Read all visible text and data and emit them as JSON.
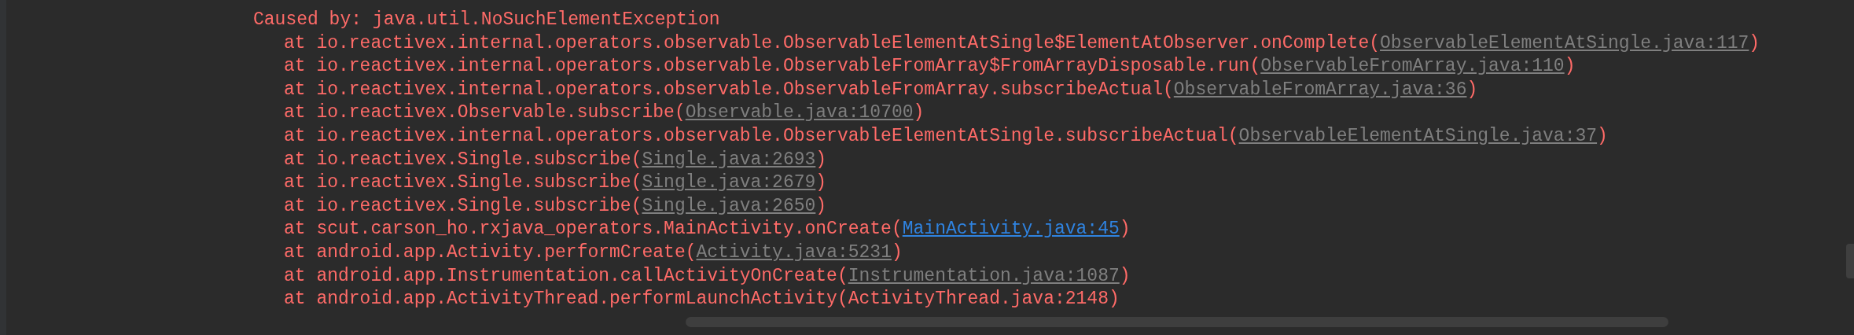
{
  "console": {
    "lines": [
      {
        "kind": "cause",
        "text": "Caused by: java.util.NoSuchElementException"
      },
      {
        "kind": "frame",
        "text": "at io.reactivex.internal.operators.observable.ObservableElementAtSingle$ElementAtObserver.onComplete(",
        "link": {
          "kind": "library",
          "text": "ObservableElementAtSingle.java:117"
        },
        "tail": ")"
      },
      {
        "kind": "frame",
        "text": "at io.reactivex.internal.operators.observable.ObservableFromArray$FromArrayDisposable.run(",
        "link": {
          "kind": "library",
          "text": "ObservableFromArray.java:110"
        },
        "tail": ")"
      },
      {
        "kind": "frame",
        "text": "at io.reactivex.internal.operators.observable.ObservableFromArray.subscribeActual(",
        "link": {
          "kind": "library",
          "text": "ObservableFromArray.java:36"
        },
        "tail": ")"
      },
      {
        "kind": "frame",
        "text": "at io.reactivex.Observable.subscribe(",
        "link": {
          "kind": "library",
          "text": "Observable.java:10700"
        },
        "tail": ")"
      },
      {
        "kind": "frame",
        "text": "at io.reactivex.internal.operators.observable.ObservableElementAtSingle.subscribeActual(",
        "link": {
          "kind": "library",
          "text": "ObservableElementAtSingle.java:37"
        },
        "tail": ")"
      },
      {
        "kind": "frame",
        "text": "at io.reactivex.Single.subscribe(",
        "link": {
          "kind": "library",
          "text": "Single.java:2693"
        },
        "tail": ")"
      },
      {
        "kind": "frame",
        "text": "at io.reactivex.Single.subscribe(",
        "link": {
          "kind": "library",
          "text": "Single.java:2679"
        },
        "tail": ")"
      },
      {
        "kind": "frame",
        "text": "at io.reactivex.Single.subscribe(",
        "link": {
          "kind": "library",
          "text": "Single.java:2650"
        },
        "tail": ")"
      },
      {
        "kind": "frame",
        "text": "at scut.carson_ho.rxjava_operators.MainActivity.onCreate(",
        "link": {
          "kind": "project",
          "text": "MainActivity.java:45"
        },
        "tail": ")"
      },
      {
        "kind": "frame",
        "text": "at android.app.Activity.performCreate(",
        "link": {
          "kind": "library",
          "text": "Activity.java:5231"
        },
        "tail": ")"
      },
      {
        "kind": "frame",
        "text": "at android.app.Instrumentation.callActivityOnCreate(",
        "link": {
          "kind": "library",
          "text": "Instrumentation.java:1087"
        },
        "tail": ")"
      },
      {
        "kind": "frame",
        "text": "at android.app.ActivityThread.performLaunchActivity(ActivityThread.java:2148)"
      }
    ]
  }
}
